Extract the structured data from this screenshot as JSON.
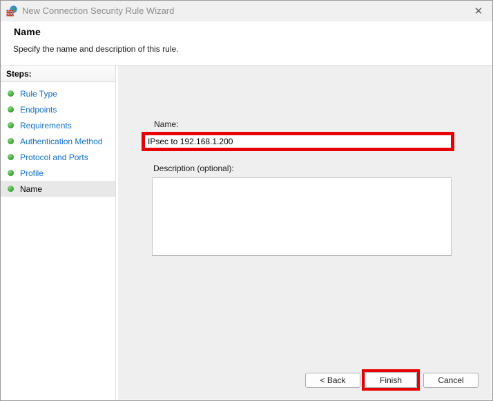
{
  "window": {
    "title": "New Connection Security Rule Wizard",
    "close_glyph": "✕"
  },
  "header": {
    "title": "Name",
    "subtitle": "Specify the name and description of this rule."
  },
  "sidebar": {
    "heading": "Steps:",
    "items": [
      {
        "label": "Rule Type",
        "active": false
      },
      {
        "label": "Endpoints",
        "active": false
      },
      {
        "label": "Requirements",
        "active": false
      },
      {
        "label": "Authentication Method",
        "active": false
      },
      {
        "label": "Protocol and Ports",
        "active": false
      },
      {
        "label": "Profile",
        "active": false
      },
      {
        "label": "Name",
        "active": true
      }
    ]
  },
  "main": {
    "name_label": "Name:",
    "name_value": "IPsec to 192.168.1.200",
    "description_label": "Description (optional):",
    "description_value": ""
  },
  "footer": {
    "back_label": "< Back",
    "finish_label": "Finish",
    "cancel_label": "Cancel"
  },
  "colors": {
    "annotation_red": "#e80000",
    "link_blue": "#1070d2",
    "bullet_green": "#3aa435",
    "titlebar_bg": "#f0f0f0",
    "main_bg": "#efefef"
  }
}
